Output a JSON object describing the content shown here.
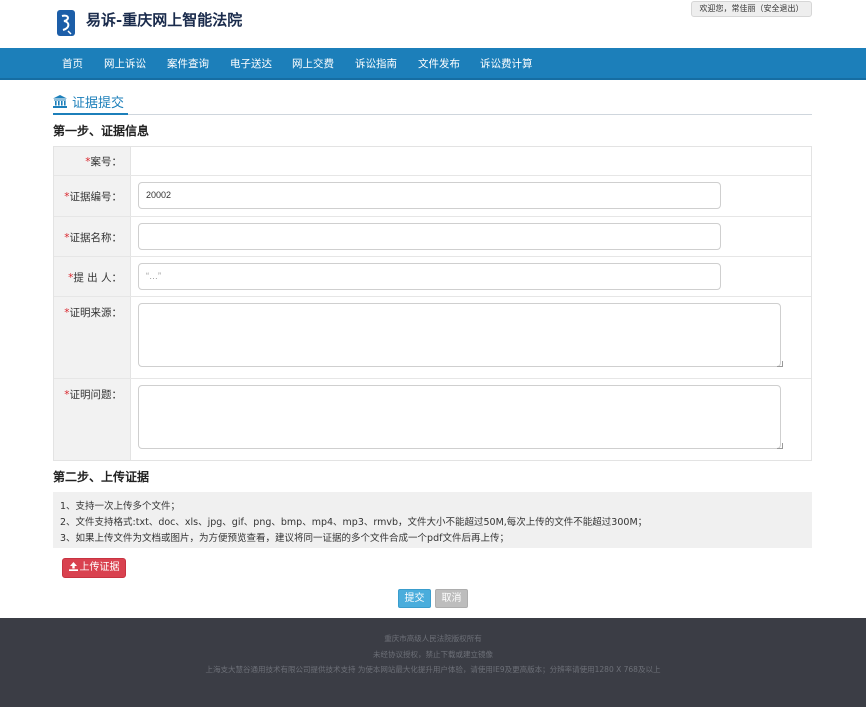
{
  "header": {
    "logo_icon": "yisu-court-logo",
    "title": "易诉-重庆网上智能法院",
    "user_greeting": "欢迎您，常佳丽",
    "logout_label": "（安全退出）"
  },
  "nav": {
    "items": [
      "首页",
      "网上诉讼",
      "案件查询",
      "电子送达",
      "网上交费",
      "诉讼指南",
      "文件发布",
      "诉讼费计算"
    ]
  },
  "page": {
    "section_icon": "bank-icon",
    "section_title": "证据提交",
    "step1_title": "第一步、证据信息",
    "step2_title": "第二步、上传证据"
  },
  "form": {
    "case_no": {
      "label": "案号：",
      "value": ""
    },
    "evidence_no": {
      "label": "证据编号：",
      "value": "20002"
    },
    "evidence_name": {
      "label": "证据名称：",
      "value": ""
    },
    "submitter": {
      "label": "提 出 人：",
      "value": "“…”"
    },
    "source": {
      "label": "证明来源：",
      "value": ""
    },
    "purpose": {
      "label": "证明问题：",
      "value": ""
    },
    "required_mark": "*"
  },
  "notes": [
    "1、支持一次上传多个文件；",
    "2、文件支持格式:txt、doc、xls、jpg、gif、png、bmp、mp4、mp3、rmvb，文件大小不能超过50M,每次上传的文件不能超过300M；",
    "3、如果上传文件为文档或图片，为方便预览查看，建议将同一证据的多个文件合成一个pdf文件后再上传；"
  ],
  "buttons": {
    "upload_icon": "upload-icon",
    "upload": "上传证据",
    "submit": "提交",
    "cancel": "取消"
  },
  "footer": {
    "line1": "重庆市高级人民法院版权所有",
    "line2": "未经协议授权，禁止下载或建立镜像",
    "line3": "上海支大慧谷通用技术有限公司提供技术支持    为使本网站最大化提升用户体验，请使用IE9及更高版本；分辨率请使用1280 X 768及以上"
  },
  "colors": {
    "nav_bg": "#1c7fba",
    "accent": "#1c7fba",
    "required": "#d9272e",
    "upload_btn": "#d9414f",
    "submit_btn": "#4aaddc",
    "cancel_btn": "#bdbdbd",
    "footer_bg": "#3b3d45"
  }
}
